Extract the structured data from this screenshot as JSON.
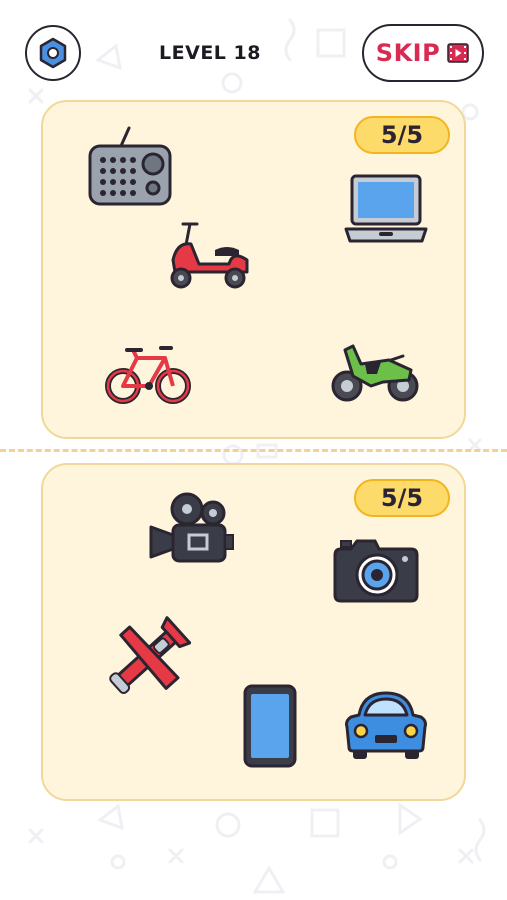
{
  "header": {
    "level_label": "LEVEL 18",
    "skip_label": "SKIP",
    "settings_icon": "hexagon-settings-icon",
    "skip_icon": "video-ad-icon"
  },
  "panels": [
    {
      "id": "top",
      "counter": "5/5",
      "items": [
        "radio",
        "laptop",
        "scooter",
        "bicycle",
        "motorcycle"
      ]
    },
    {
      "id": "bottom",
      "counter": "5/5",
      "items": [
        "movie-camera",
        "photo-camera",
        "airplane",
        "smartphone",
        "car"
      ]
    }
  ],
  "colors": {
    "panel_bg": "#fff5dd",
    "panel_border": "#f0d89a",
    "counter_bg": "#fddb6b",
    "counter_border": "#f2b51e",
    "skip_text": "#d92a52",
    "divider": "#f5cf94"
  }
}
